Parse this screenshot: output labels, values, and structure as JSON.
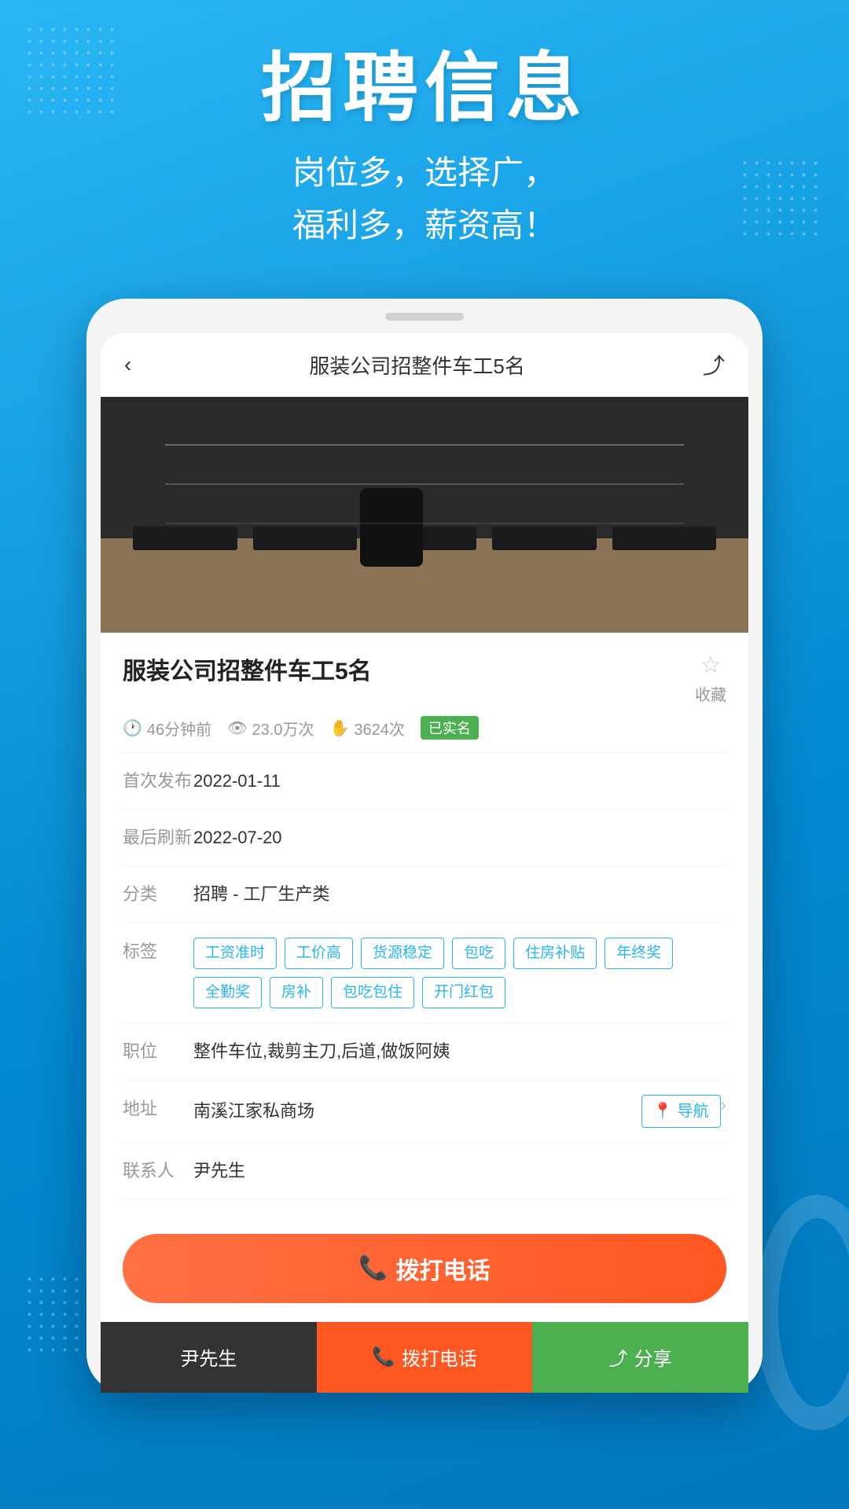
{
  "header": {
    "title": "招聘信息",
    "subtitle_line1": "岗位多，选择广，",
    "subtitle_line2": "福利多，薪资高！"
  },
  "nav": {
    "back_icon": "‹",
    "title": "服装公司招整件车工5名",
    "share_icon": "⤴"
  },
  "job": {
    "title": "服装公司招整件车工5名",
    "time_ago": "46分钟前",
    "views": "23.0万次",
    "applications": "3624次",
    "verified_label": "已实名",
    "collect_label": "收藏",
    "first_publish": "2022-01-11",
    "last_refresh": "2022-07-20",
    "category": "招聘 - 工厂生产类",
    "tags": [
      "工资准时",
      "工价高",
      "货源稳定",
      "包吃",
      "住房补贴",
      "年终奖",
      "全勤奖",
      "房补",
      "包吃包住",
      "开门红包"
    ],
    "positions": "整件车位,裁剪主刀,后道,做饭阿姨",
    "address": "南溪江家私商场",
    "nav_label": "导航",
    "contact": "尹先生",
    "call_label": "拨打电话"
  },
  "labels": {
    "first_publish": "首次发布",
    "last_refresh": "最后刷新",
    "category": "分类",
    "tags": "标签",
    "positions": "职位",
    "address": "地址",
    "contact": "联系人"
  },
  "bottom_bar": {
    "user_label": "尹先生",
    "call_label": "拨打电话",
    "share_label": "分享",
    "call_icon": "📞",
    "share_icon": "⤴"
  }
}
